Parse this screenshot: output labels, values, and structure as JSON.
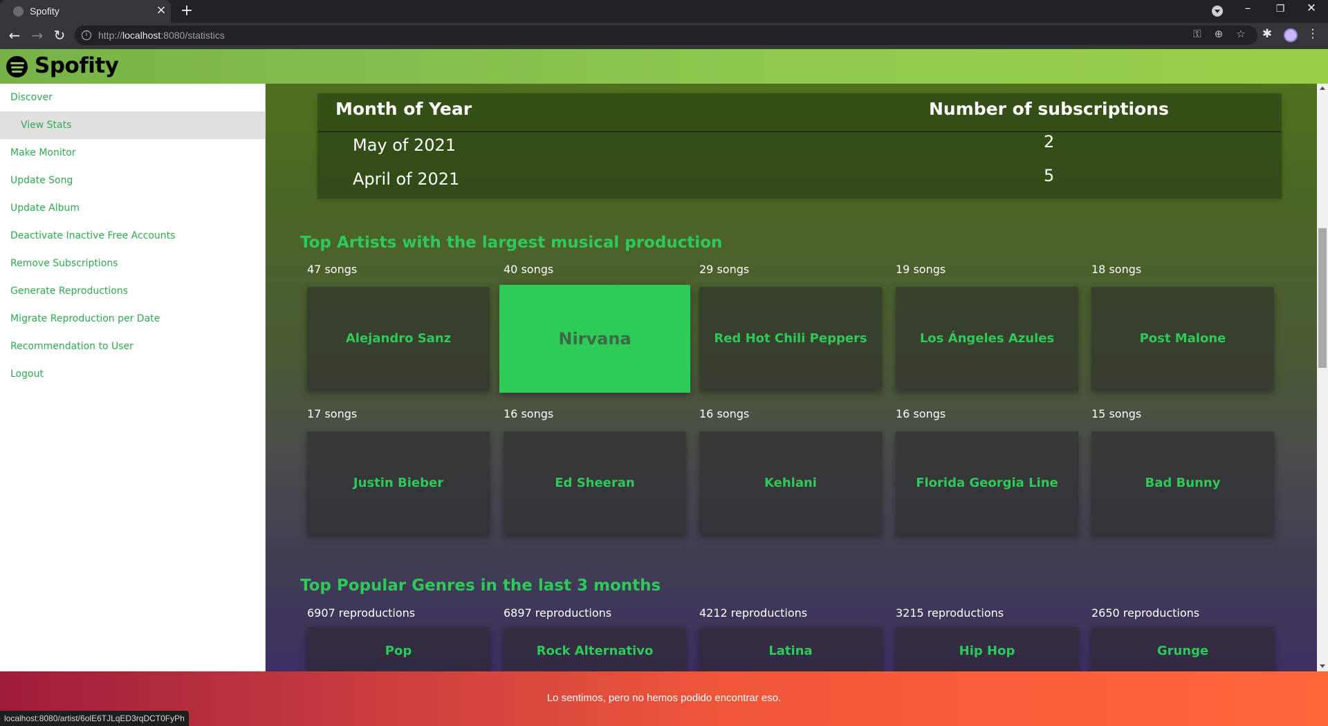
{
  "browser": {
    "tab_title": "Spofity",
    "tab_close": "×",
    "new_tab": "+",
    "url_prefix": "http://",
    "url_host": "localhost",
    "url_rest": ":8080/statistics",
    "status_url": "localhost:8080/artist/6olE6TJLqED3rqDCT0FyPh",
    "controls": {
      "minimize": "–",
      "restore": "❐",
      "close": "✕",
      "back": "←",
      "forward": "→",
      "reload": "↻",
      "menu": "⋮"
    }
  },
  "app": {
    "brand": "Spofity",
    "brand_color": "#8cc94f",
    "accent": "#2ec95a"
  },
  "sidebar": {
    "items": [
      {
        "label": "Discover"
      },
      {
        "label": "View Stats",
        "active": true
      },
      {
        "label": "Make Monitor"
      },
      {
        "label": "Update Song"
      },
      {
        "label": "Update Album"
      },
      {
        "label": "Deactivate Inactive Free Accounts"
      },
      {
        "label": "Remove Subscriptions"
      },
      {
        "label": "Generate Reproductions"
      },
      {
        "label": "Migrate Reproduction per Date"
      },
      {
        "label": "Recommendation to User"
      },
      {
        "label": "Logout"
      }
    ]
  },
  "subscriptions_table": {
    "headers": [
      "Month of Year",
      "Number of subscriptions"
    ],
    "rows": [
      {
        "month": "May of 2021",
        "count": "2"
      },
      {
        "month": "April of 2021",
        "count": "5"
      }
    ]
  },
  "top_artists": {
    "title": "Top Artists with the largest musical production",
    "items": [
      {
        "count": "47 songs",
        "name": "Alejandro Sanz"
      },
      {
        "count": "40 songs",
        "name": "Nirvana"
      },
      {
        "count": "29 songs",
        "name": "Red Hot Chili Peppers"
      },
      {
        "count": "19 songs",
        "name": "Los Ángeles Azules"
      },
      {
        "count": "18 songs",
        "name": "Post Malone"
      },
      {
        "count": "17 songs",
        "name": "Justin Bieber"
      },
      {
        "count": "16 songs",
        "name": "Ed Sheeran"
      },
      {
        "count": "16 songs",
        "name": "Kehlani"
      },
      {
        "count": "16 songs",
        "name": "Florida Georgia Line"
      },
      {
        "count": "15 songs",
        "name": "Bad Bunny"
      }
    ]
  },
  "top_genres": {
    "title": "Top Popular Genres in the last 3 months",
    "items": [
      {
        "count": "6907 reproductions",
        "name": "Pop"
      },
      {
        "count": "6897 reproductions",
        "name": "Rock Alternativo"
      },
      {
        "count": "4212 reproductions",
        "name": "Latina"
      },
      {
        "count": "3215 reproductions",
        "name": "Hip Hop"
      },
      {
        "count": "2650 reproductions",
        "name": "Grunge"
      }
    ]
  },
  "banner": {
    "message": "Lo sentimos, pero no hemos podido encontrar eso."
  }
}
